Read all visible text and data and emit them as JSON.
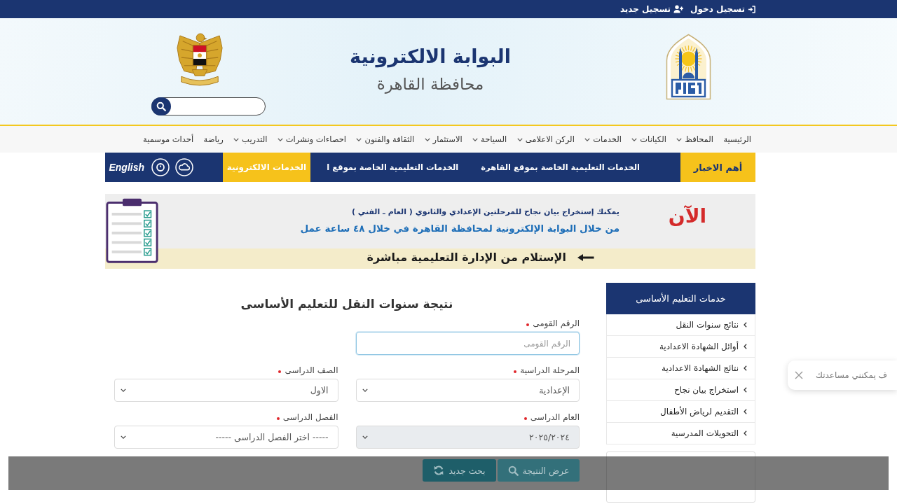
{
  "top_bar": {
    "links": [
      {
        "kind": "login",
        "label": "تسجيل دخول"
      },
      {
        "kind": "register",
        "label": "تسجيل جديد"
      }
    ]
  },
  "header": {
    "title": "البوابة الالكترونية",
    "subtitle": "محافظة القاهرة"
  },
  "nav": {
    "items": [
      {
        "label": "الرئيسية",
        "dropdown": false
      },
      {
        "label": "المحافظ",
        "dropdown": true
      },
      {
        "label": "الكيانات",
        "dropdown": true
      },
      {
        "label": "الخدمات",
        "dropdown": true
      },
      {
        "label": "الركن الاعلامى",
        "dropdown": true
      },
      {
        "label": "السياحة",
        "dropdown": true
      },
      {
        "label": "الاستثمار",
        "dropdown": true
      },
      {
        "label": "الثقافة والفنون",
        "dropdown": true
      },
      {
        "label": "احصاءات ونشرات",
        "dropdown": true
      },
      {
        "label": "التدريب",
        "dropdown": true
      },
      {
        "label": "رياضة",
        "dropdown": false
      },
      {
        "label": "أحداث موسمية",
        "dropdown": false
      }
    ]
  },
  "news_bar": {
    "heading": "أهم الاخبار",
    "headlines": [
      "الخدمات التعليمية الخاصة بموقع القاهرة",
      "الخدمات التعليمية الخاصة بموقع ا"
    ],
    "eservices": "الخدمات الالكترونية",
    "language": "English"
  },
  "banner": {
    "badge": "الآن",
    "lines": [
      "يمكنك إستخراج بيان نجاح للمرحلتين الإعدادي والثانوي ( العام ـ الفني )",
      "من خلال البوابة الإلكترونية لمحافظة القاهرة في خلال ٤٨ ساعة عمل"
    ],
    "note": "الإستلام من الإدارة التعليمية مباشرة"
  },
  "sidebar": {
    "title": "خدمات التعليم الأساسى",
    "items": [
      "نتائج سنوات النقل",
      "أوائل الشهادة الاعدادية",
      "نتائج الشهادة الاعدادية",
      "استخراج بيان نجاح",
      "التقديم لرياض الأطفال",
      "التحويلات المدرسية"
    ]
  },
  "form": {
    "title": "نتيجة سنوات النقل للتعليم الأساسى",
    "rows": [
      {
        "fields": [
          {
            "kind": "text",
            "label": "الرقم القومى",
            "required": true,
            "placeholder": "الرقم القومى",
            "focused": true
          }
        ]
      },
      {
        "fields": [
          {
            "kind": "select",
            "label": "المرحلة الدراسية",
            "required": true,
            "value": "الإعدادية",
            "disabled": false
          },
          {
            "kind": "select",
            "label": "الصف الدراسى",
            "required": true,
            "value": "الاول",
            "disabled": false
          }
        ]
      },
      {
        "fields": [
          {
            "kind": "select",
            "label": "العام الدراسى",
            "required": true,
            "value": "٢٠٢٥/٢٠٢٤",
            "disabled": true
          },
          {
            "kind": "select",
            "label": "الفصل الدراسى",
            "required": true,
            "value": "----- اختر الفصل الدراسى -----",
            "disabled": false
          }
        ]
      }
    ],
    "buttons": [
      {
        "kind": "submit",
        "label": "عرض النتيجة"
      },
      {
        "kind": "reset",
        "label": "بحث جديد"
      }
    ]
  },
  "chat": {
    "message": "ف يمكنني مساعدتك"
  }
}
